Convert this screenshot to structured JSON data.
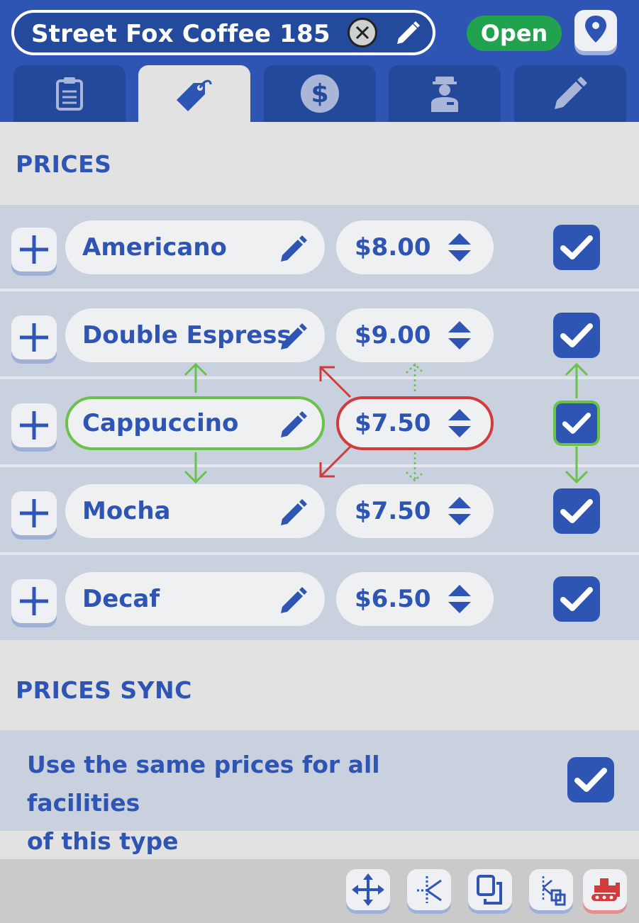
{
  "header": {
    "facility_name": "Street Fox Coffee 185",
    "status": "Open",
    "colors": {
      "header_blue": "#2f55b4",
      "status_green": "#21a24f",
      "text_blue": "#2f55b4"
    }
  },
  "tabs": [
    {
      "icon": "clipboard-icon",
      "active": false
    },
    {
      "icon": "price-tag-icon",
      "active": true
    },
    {
      "icon": "dollar-icon",
      "active": false
    },
    {
      "icon": "staff-icon",
      "active": false
    },
    {
      "icon": "pencil-icon",
      "active": false
    }
  ],
  "prices": {
    "title": "PRICES",
    "items": [
      {
        "name": "Americano",
        "price": "$8.00",
        "enabled": true
      },
      {
        "name": "Double Espress",
        "price": "$9.00",
        "enabled": true
      },
      {
        "name": "Cappuccino",
        "price": "$7.50",
        "enabled": true,
        "highlighted": true
      },
      {
        "name": "Mocha",
        "price": "$7.50",
        "enabled": true
      },
      {
        "name": "Decaf",
        "price": "$6.50",
        "enabled": true
      }
    ]
  },
  "prices_sync": {
    "title": "PRICES SYNC",
    "text_line1": "Use the same prices for all facilities",
    "text_line2": "of this type",
    "enabled": true
  },
  "footer_tools": [
    {
      "icon": "move-icon"
    },
    {
      "icon": "rotate-icon"
    },
    {
      "icon": "copy-icon"
    },
    {
      "icon": "copy-settings-icon"
    },
    {
      "icon": "bulldozer-icon",
      "danger": true
    }
  ]
}
